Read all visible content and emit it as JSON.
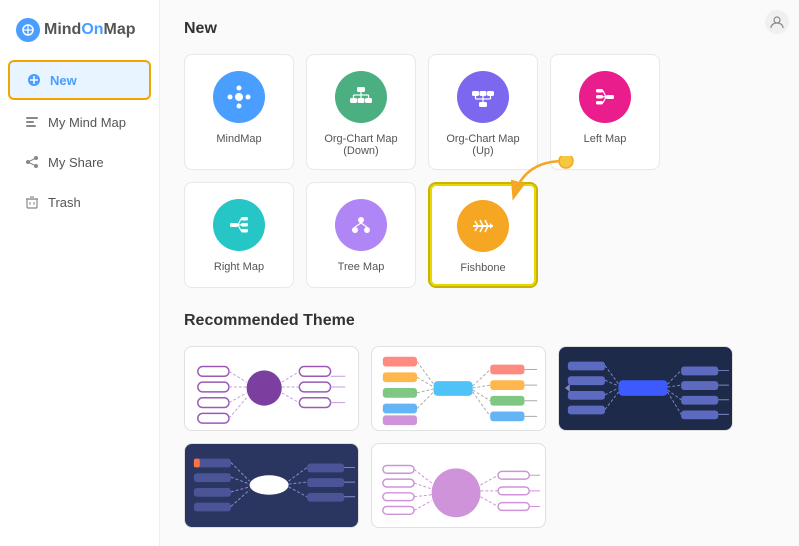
{
  "logo": {
    "text_mind": "Mind",
    "text_on": "On",
    "text_map": "Map"
  },
  "sidebar": {
    "items": [
      {
        "id": "new",
        "label": "New",
        "icon": "➕",
        "active": true
      },
      {
        "id": "my-mind-map",
        "label": "My Mind Map",
        "icon": "🗺",
        "active": false
      },
      {
        "id": "my-share",
        "label": "My Share",
        "icon": "↗",
        "active": false
      },
      {
        "id": "trash",
        "label": "Trash",
        "icon": "🗑",
        "active": false
      }
    ]
  },
  "new_section": {
    "title": "New",
    "maps": [
      {
        "id": "mindmap",
        "label": "MindMap",
        "color": "#4a9eff",
        "icon": "⊕"
      },
      {
        "id": "org-chart-down",
        "label": "Org-Chart Map (Down)",
        "color": "#4caf82",
        "icon": "⊞"
      },
      {
        "id": "org-chart-up",
        "label": "Org-Chart Map (Up)",
        "color": "#7b68ee",
        "icon": "⊕"
      },
      {
        "id": "left-map",
        "label": "Left Map",
        "color": "#e91e8c",
        "icon": "⊟"
      },
      {
        "id": "right-map",
        "label": "Right Map",
        "color": "#26c6c6",
        "icon": "⊞"
      },
      {
        "id": "tree-map",
        "label": "Tree Map",
        "color": "#b085f5",
        "icon": "⊕"
      },
      {
        "id": "fishbone",
        "label": "Fishbone",
        "color": "#f5a623",
        "icon": "✳"
      }
    ]
  },
  "recommended_section": {
    "title": "Recommended Theme"
  },
  "top_right": {
    "icon": "👤"
  }
}
